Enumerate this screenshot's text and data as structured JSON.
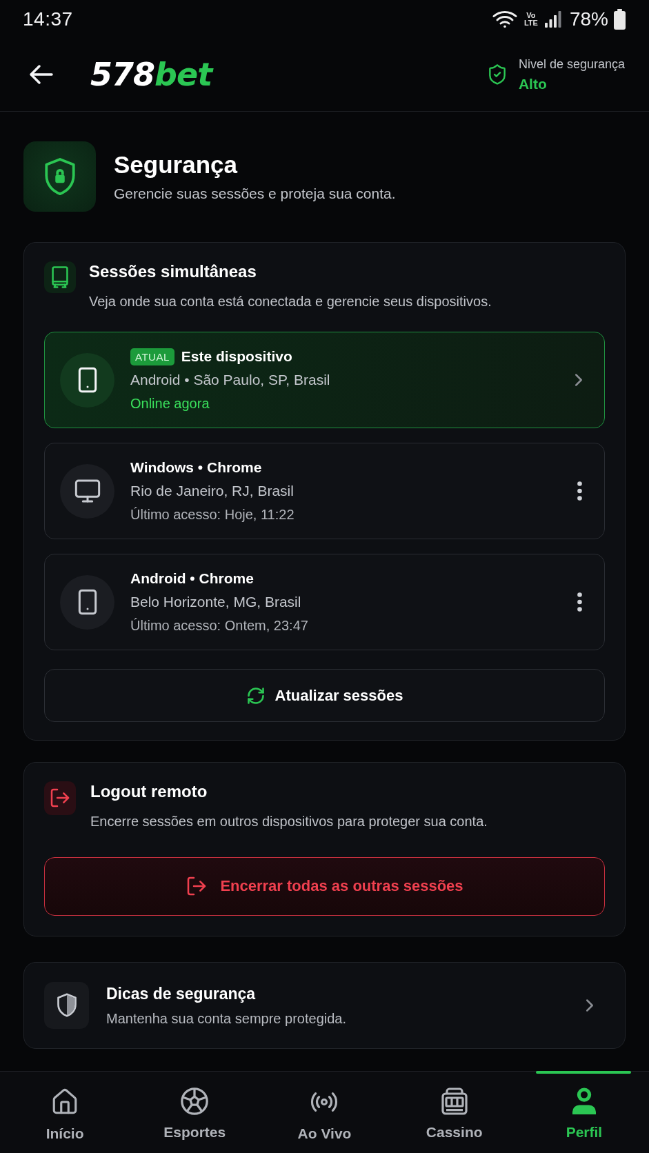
{
  "status_bar": {
    "time": "14:37",
    "network": "Vo LTE",
    "battery": "78%"
  },
  "header": {
    "logo": {
      "text": "578",
      "accent": "bet"
    },
    "security_level": {
      "label": "Nivel de segurança",
      "value": "Alto"
    }
  },
  "page": {
    "title": "Segurança",
    "subtitle": "Gerencie suas sessões e proteja sua conta."
  },
  "sessions": {
    "title": "Sessões simultâneas",
    "description": "Veja onde sua conta está conectada e gerencie seus dispositivos.",
    "devices": [
      {
        "kind": "mobile",
        "current": true,
        "badge": "ATUAL",
        "title": "Este dispositivo",
        "location": "Android • São Paulo, SP, Brasil",
        "status": "Online agora"
      },
      {
        "kind": "desktop",
        "current": false,
        "title": "Windows • Chrome",
        "location": "Rio de Janeiro, RJ, Brasil",
        "status": "Último acesso: Hoje, 11:22"
      },
      {
        "kind": "mobile",
        "current": false,
        "title": "Android • Chrome",
        "location": "Belo Horizonte, MG, Brasil",
        "status": "Último acesso: Ontem, 23:47"
      }
    ],
    "refresh_button": "Atualizar sessões"
  },
  "remote_logout": {
    "title": "Logout remoto",
    "description": "Encerre sessões em outros dispositivos para proteger sua conta.",
    "button": "Encerrar todas as outras sessões"
  },
  "tips": {
    "title": "Dicas de segurança",
    "description": "Mantenha sua conta sempre protegida."
  },
  "bottom_nav": [
    {
      "label": "Início",
      "selected": false
    },
    {
      "label": "Esportes",
      "selected": false
    },
    {
      "label": "Ao Vivo",
      "selected": false
    },
    {
      "label": "Cassino",
      "selected": false
    },
    {
      "label": "Perfil",
      "selected": true
    }
  ]
}
